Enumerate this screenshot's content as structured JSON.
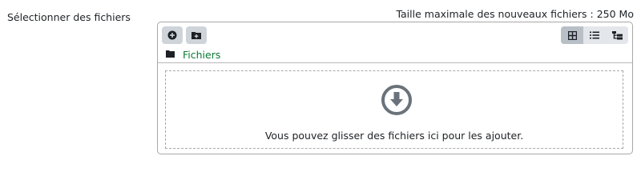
{
  "form": {
    "field_label": "Sélectionner des fichiers",
    "max_size_text": "Taille maximale des nouveaux fichiers : 250 Mo"
  },
  "filemanager": {
    "toolbar": {
      "add_icon": "plus-circle-icon",
      "mkdir_icon": "folder-plus-icon",
      "views": [
        {
          "icon": "grid-icon",
          "active": true
        },
        {
          "icon": "list-icon",
          "active": false
        },
        {
          "icon": "tree-icon",
          "active": false
        }
      ]
    },
    "path": {
      "folder_icon": "folder-icon",
      "label": "Fichiers"
    },
    "dropzone": {
      "icon": "arrow-down-circle-icon",
      "text": "Vous pouvez glisser des fichiers ici pour les ajouter."
    }
  },
  "colors": {
    "link": "#0b7a34",
    "button_bg": "#ced4da",
    "icon_gray": "#6a737b",
    "border": "#a8a8a8"
  }
}
